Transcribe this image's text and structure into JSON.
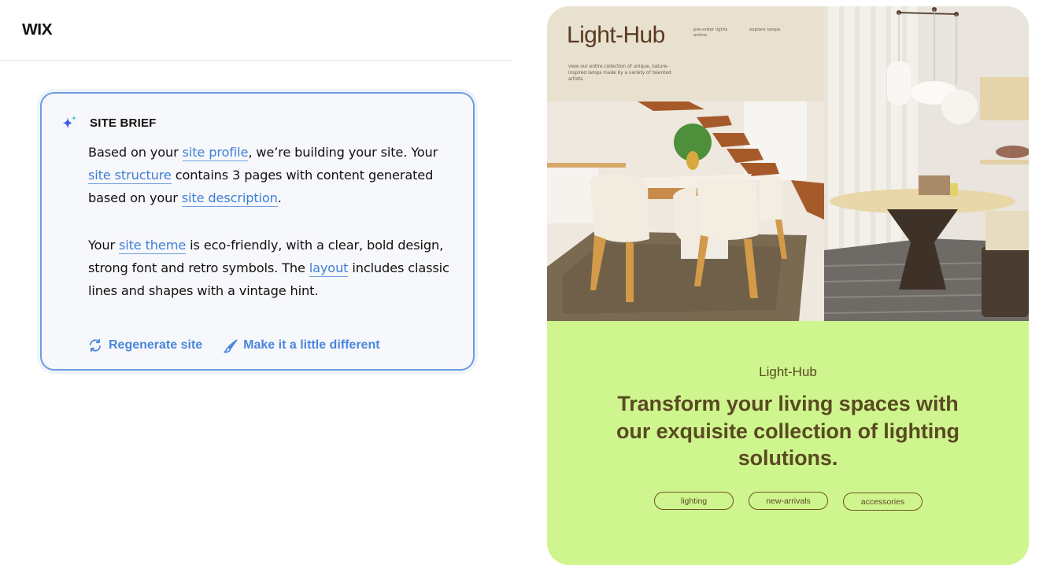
{
  "editor": {
    "logo": "WIX",
    "site_brief": {
      "title": "SITE BRIEF",
      "icon": "sparkle-icon",
      "paragraph1": {
        "t1": "Based on your ",
        "link1": "site profile",
        "t2": ", we’re building your site. Your ",
        "link2": "site structure",
        "t3": " contains 3 pages with content generated based on your ",
        "link3": "site description",
        "t4": "."
      },
      "paragraph2": {
        "t1": "Your ",
        "link1": "site theme",
        "t2": " is eco-friendly, with a clear, bold design, strong font and retro symbols. The ",
        "link2": "layout",
        "t3": " includes classic lines and shapes with a vintage hint."
      },
      "actions": [
        {
          "label": "Regenerate site",
          "icon": "refresh-icon"
        },
        {
          "label": "Make it a little different",
          "icon": "brush-icon"
        }
      ],
      "accent_color": "#4a86dc"
    }
  },
  "preview": {
    "header": {
      "logo": "Light-Hub",
      "nav": [
        "pre-order lights online",
        "explore lamps"
      ],
      "blurb": "view our entire collection of unique, nature-inspired lamps made by a variety of talented artists."
    },
    "images": [
      {
        "alt": "dining room with white chairs, wooden table and staircase"
      },
      {
        "alt": "pendant lamps over round table"
      }
    ],
    "section": {
      "brand": "Light-Hub",
      "headline": "Transform your living spaces with our exquisite collection of lighting solutions.",
      "tags": [
        "lighting",
        "new-arrivals",
        "accessories"
      ],
      "background_color": "#cff58f",
      "text_color": "#5a4a22"
    }
  }
}
